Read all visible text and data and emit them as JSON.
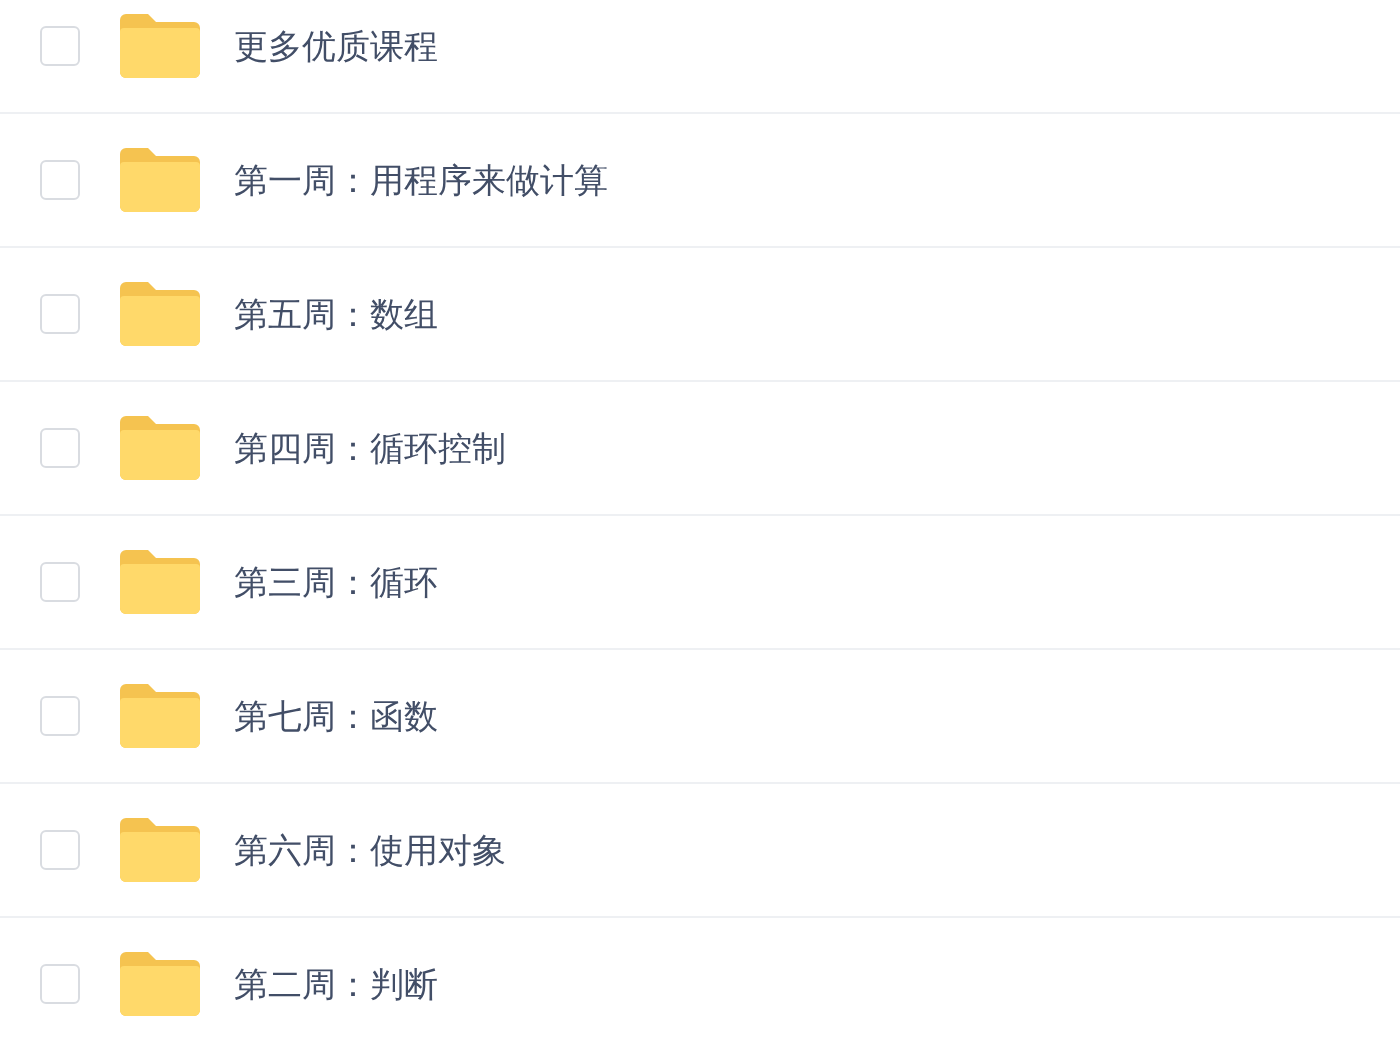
{
  "items": [
    {
      "name": "更多优质课程",
      "checked": false
    },
    {
      "name": "第一周：用程序来做计算",
      "checked": false
    },
    {
      "name": "第五周：数组",
      "checked": false
    },
    {
      "name": "第四周：循环控制",
      "checked": false
    },
    {
      "name": "第三周：循环",
      "checked": false
    },
    {
      "name": "第七周：函数",
      "checked": false
    },
    {
      "name": "第六周：使用对象",
      "checked": false
    },
    {
      "name": "第二周：判断",
      "checked": false
    }
  ]
}
